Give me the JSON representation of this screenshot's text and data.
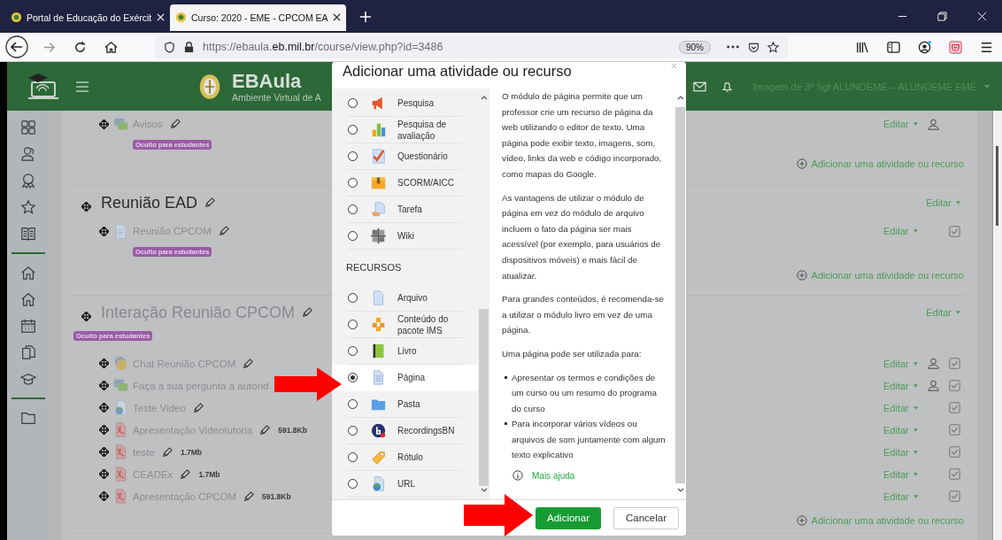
{
  "browser": {
    "tabs": [
      {
        "title": "Portal de Educação do Exércit",
        "selected": false
      },
      {
        "title": "Curso: 2020 - EME - CPCOM EA",
        "selected": true
      }
    ],
    "url": "https://ebaula.**eb.mil.br**/course/view.php?id=3486",
    "zoom": "90%"
  },
  "header": {
    "brand": "EBAula",
    "subtitle": "Ambiente Virtual de A",
    "user": "Imagem de 3º Sgt ALUNOEME – ALUNOEME EME"
  },
  "sections": [
    {
      "items": [
        {
          "kind": "forum",
          "name": "Avisos",
          "badge": "Oculto para estudantes",
          "edit": "Editar",
          "group_icon": true
        }
      ],
      "add_link": "Adicionar uma atividade ou recurso"
    },
    {
      "title": "Reunião EAD",
      "hidden": false,
      "edit": "Editar",
      "items": [
        {
          "kind": "page",
          "name": "Reunião CPCOM",
          "badge": "Oculto para estudantes",
          "edit": "Editar",
          "group_icon": false,
          "checked": true
        }
      ],
      "add_link": "Adicionar uma atividade ou recurso"
    },
    {
      "title": "Interação Reunião CPCOM",
      "hidden": true,
      "title_badge": "Oculto para estudantes",
      "edit": "Editar",
      "items": [
        {
          "kind": "chat",
          "name": "Chat Reunião CPCOM",
          "edit": "Editar",
          "group_icon": true,
          "checked": true
        },
        {
          "kind": "forum",
          "name": "Faça a sua pergunta a autorid",
          "edit": "Editar",
          "group_icon": true,
          "checked": true
        },
        {
          "kind": "url",
          "name": "Teste Video",
          "edit": "Editar",
          "group_icon": false,
          "checked": true
        },
        {
          "kind": "file",
          "name": "Apresentação Videotutoria",
          "size": "591.8Kb",
          "edit": "Editar",
          "group_icon": false,
          "checked": true
        },
        {
          "kind": "file",
          "name": "teste",
          "size": "1.7Mb",
          "edit": "Editar",
          "group_icon": false,
          "checked": true
        },
        {
          "kind": "file",
          "name": "CEADEx",
          "size": "1.7Mb",
          "edit": "Editar",
          "group_icon": false,
          "checked": true
        },
        {
          "kind": "file",
          "name": "Apresentação CPCOM",
          "size": "591.8Kb",
          "edit": "Editar",
          "group_icon": false,
          "checked": true
        }
      ],
      "add_link": "Adicionar uma atividade ou recurso"
    }
  ],
  "modal": {
    "title": "Adicionar uma atividade ou recurso",
    "groups": [
      {
        "options": [
          {
            "label": "Pesquisa",
            "selected": false
          },
          {
            "label": "Pesquisa de avaliação",
            "selected": false
          },
          {
            "label": "Questionário",
            "selected": false
          },
          {
            "label": "SCORM/AICC",
            "selected": false
          },
          {
            "label": "Tarefa",
            "selected": false
          },
          {
            "label": "Wiki",
            "selected": false
          }
        ]
      },
      {
        "heading": "RECURSOS",
        "options": [
          {
            "label": "Arquivo",
            "selected": false
          },
          {
            "label": "Conteúdo do pacote IMS",
            "selected": false
          },
          {
            "label": "Livro",
            "selected": false
          },
          {
            "label": "Página",
            "selected": true
          },
          {
            "label": "Pasta",
            "selected": false
          },
          {
            "label": "RecordingsBN",
            "selected": false
          },
          {
            "label": "Rótulo",
            "selected": false
          },
          {
            "label": "URL",
            "selected": false
          }
        ]
      }
    ],
    "description": {
      "paragraphs": [
        "O módulo de página permite que um professor crie um recurso de página da web utilizando o editor de texto. Uma página pode exibir texto, imagens, som, vídeo, links da web e código incorporado, como mapas do Google.",
        "As vantagens de utilizar o módulo de página em vez do módulo de arquivo incluem o fato da página ser mais acessível (por exemplo, para usuários de dispositivos móveis) e mais fácil de atualizar.",
        "Para grandes conteúdos, é recomenda-se a utilizar o módulo livro em vez de uma página.",
        "Uma página pode ser utilizada para:"
      ],
      "bullets": [
        "Apresentar os termos e condições de um curso ou um resumo do programa do curso",
        "Para incorporar vários vídeos ou arquivos de som juntamente com algum texto explicativo"
      ],
      "help_link": "Mais ajuda"
    },
    "buttons": [
      {
        "label": "Adicionar",
        "kind": "primary"
      },
      {
        "label": "Cancelar",
        "kind": "secondary"
      }
    ]
  }
}
